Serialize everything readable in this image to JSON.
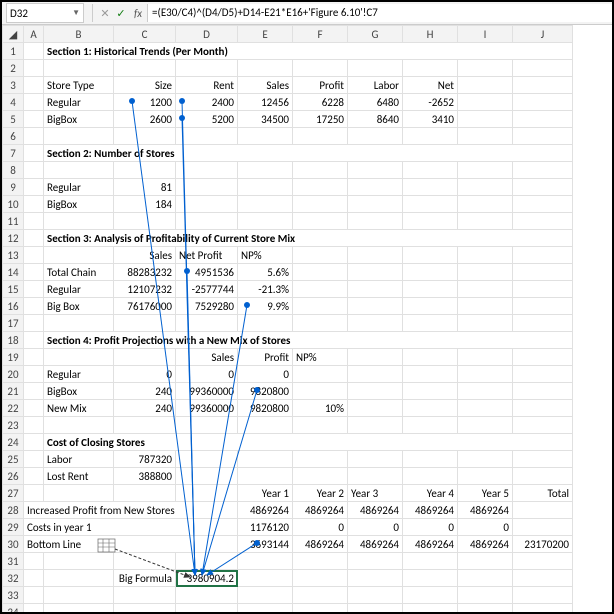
{
  "namebox": "D32",
  "formula": "=(E30/C4)^(D4/D5)+D14-E21*E16+'Figure 6.10'!C7",
  "cols": [
    "A",
    "B",
    "C",
    "D",
    "E",
    "F",
    "G",
    "H",
    "I",
    "J"
  ],
  "s1": {
    "title": "Section 1: Historical Trends (Per Month)",
    "hdr": {
      "b": "Store Type",
      "c": "Size",
      "d": "Rent",
      "e": "Sales",
      "f": "Profit",
      "g": "Labor",
      "h": "Net"
    },
    "r4": {
      "b": "Regular",
      "c": "1200",
      "d": "2400",
      "e": "12456",
      "f": "6228",
      "g": "6480",
      "h": "-2652"
    },
    "r5": {
      "b": "BigBox",
      "c": "2600",
      "d": "5200",
      "e": "34500",
      "f": "17250",
      "g": "8640",
      "h": "3410"
    }
  },
  "s2": {
    "title": "Section 2: Number of Stores",
    "r9": {
      "b": "Regular",
      "c": "81"
    },
    "r10": {
      "b": "BigBox",
      "c": "184"
    }
  },
  "s3": {
    "title": "Section 3: Analysis of Profitability of Current Store Mix",
    "hdr": {
      "c": "Sales",
      "d": "Net Profit",
      "e": "NP%"
    },
    "r14": {
      "b": "Total Chain",
      "c": "88283232",
      "d": "4951536",
      "e": "5.6%"
    },
    "r15": {
      "b": "Regular",
      "c": "12107232",
      "d": "-2577744",
      "e": "-21.3%"
    },
    "r16": {
      "b": "Big Box",
      "c": "76176000",
      "d": "7529280",
      "e": "9.9%"
    }
  },
  "s4": {
    "title": "Section 4: Profit Projections with a New Mix of Stores",
    "hdr": {
      "d": "Sales",
      "e": "Profit",
      "f": "NP%"
    },
    "r20": {
      "b": "Regular",
      "c": "0",
      "d": "0",
      "e": "0"
    },
    "r21": {
      "b": "BigBox",
      "c": "240",
      "d": "99360000",
      "e": "9820800"
    },
    "r22": {
      "b": "New Mix",
      "c": "240",
      "d": "99360000",
      "e": "9820800",
      "f": "10%"
    }
  },
  "cost": {
    "title": "Cost of Closing Stores",
    "r25": {
      "b": "Labor",
      "c": "787320"
    },
    "r26": {
      "b": "Lost Rent",
      "c": "388800"
    }
  },
  "proj": {
    "hdr": {
      "e": "Year 1",
      "f": "Year 2",
      "g": "Year 3",
      "h": "Year 4",
      "i": "Year 5",
      "j": "Total"
    },
    "r28": {
      "a": "Increased Profit from New Stores",
      "e": "4869264",
      "f": "4869264",
      "g": "4869264",
      "h": "4869264",
      "i": "4869264"
    },
    "r29": {
      "a": "Costs in year 1",
      "e": "1176120",
      "f": "0",
      "g": "0",
      "h": "0",
      "i": "0"
    },
    "r30": {
      "a": "Bottom Line",
      "e": "3693144",
      "f": "4869264",
      "g": "4869264",
      "h": "4869264",
      "i": "4869264",
      "j": "23170200"
    }
  },
  "bigformula": {
    "label": "Big Formula",
    "value": "3980904.2"
  }
}
